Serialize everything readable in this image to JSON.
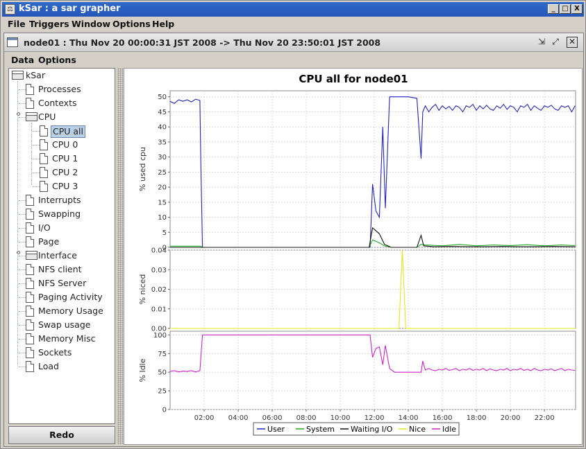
{
  "window": {
    "title": "kSar : a sar grapher",
    "controls": [
      "_",
      "□",
      "X"
    ]
  },
  "menubar": [
    "File",
    "Triggers",
    "Window",
    "Options",
    "Help"
  ],
  "inner_window": {
    "title": "node01 : Thu Nov 20 00:00:31 JST 2008 -> Thu Nov 20 23:50:01 JST 2008",
    "menus": [
      "Data",
      "Options"
    ]
  },
  "tree": {
    "root": "kSar",
    "items": [
      {
        "label": "Processes",
        "type": "leaf",
        "level": 1
      },
      {
        "label": "Contexts",
        "type": "leaf",
        "level": 1
      },
      {
        "label": "CPU",
        "type": "folder",
        "level": 1
      },
      {
        "label": "CPU all",
        "type": "leaf",
        "level": 2,
        "selected": true
      },
      {
        "label": "CPU 0",
        "type": "leaf",
        "level": 2
      },
      {
        "label": "CPU 1",
        "type": "leaf",
        "level": 2
      },
      {
        "label": "CPU 2",
        "type": "leaf",
        "level": 2
      },
      {
        "label": "CPU 3",
        "type": "leaf",
        "level": 2
      },
      {
        "label": "Interrupts",
        "type": "leaf",
        "level": 1
      },
      {
        "label": "Swapping",
        "type": "leaf",
        "level": 1
      },
      {
        "label": "I/O",
        "type": "leaf",
        "level": 1
      },
      {
        "label": "Page",
        "type": "leaf",
        "level": 1
      },
      {
        "label": "Interface",
        "type": "folder",
        "level": 1
      },
      {
        "label": "NFS client",
        "type": "leaf",
        "level": 1
      },
      {
        "label": "NFS Server",
        "type": "leaf",
        "level": 1
      },
      {
        "label": "Paging Activity",
        "type": "leaf",
        "level": 1
      },
      {
        "label": "Memory Usage",
        "type": "leaf",
        "level": 1
      },
      {
        "label": "Swap usage",
        "type": "leaf",
        "level": 1
      },
      {
        "label": "Memory Misc",
        "type": "leaf",
        "level": 1
      },
      {
        "label": "Sockets",
        "type": "leaf",
        "level": 1
      },
      {
        "label": "Load",
        "type": "leaf",
        "level": 1
      }
    ]
  },
  "redo_label": "Redo",
  "colors": {
    "user": "#2222bb",
    "system": "#22aa22",
    "waiting_io": "#111111",
    "nice": "#e6e61e",
    "idle": "#cc22cc"
  },
  "chart_data": {
    "type": "line",
    "title": "CPU all for node01",
    "x_ticks": [
      "02:00",
      "04:00",
      "06:00",
      "08:00",
      "10:00",
      "12:00",
      "14:00",
      "16:00",
      "18:00",
      "20:00",
      "22:00"
    ],
    "x_range_hours": [
      0,
      23.83
    ],
    "subplots": [
      {
        "ylabel": "% used cpu",
        "ylim": [
          0,
          52
        ],
        "y_ticks": [
          "0",
          "5",
          "10",
          "15",
          "20",
          "25",
          "30",
          "35",
          "40",
          "45",
          "50"
        ],
        "series": [
          {
            "name": "User",
            "color": "#2222bb",
            "x": [
              0,
              0.25,
              0.5,
              0.75,
              1.0,
              1.25,
              1.5,
              1.75,
              1.8,
              1.9,
              11.75,
              11.9,
              12.1,
              12.3,
              12.5,
              12.65,
              12.9,
              13.1,
              13.3,
              13.5,
              13.7,
              14.0,
              14.5,
              14.75,
              14.85,
              15.0,
              15.2,
              15.4,
              15.6,
              15.8,
              16.0,
              16.2,
              16.4,
              16.6,
              16.8,
              17.0,
              17.2,
              17.4,
              17.6,
              17.8,
              18.0,
              18.2,
              18.4,
              18.6,
              18.8,
              19.0,
              19.2,
              19.4,
              19.6,
              19.8,
              20.0,
              20.2,
              20.4,
              20.6,
              20.8,
              21.0,
              21.2,
              21.4,
              21.6,
              21.8,
              22.0,
              22.2,
              22.4,
              22.6,
              22.8,
              23.0,
              23.2,
              23.4,
              23.6,
              23.8
            ],
            "y": [
              48.5,
              47.8,
              49,
              48.5,
              49,
              48.3,
              49.2,
              48.8,
              30,
              0,
              0,
              21,
              12,
              10,
              40,
              13,
              50,
              50,
              50,
              50,
              50,
              50,
              49.5,
              29.5,
              45,
              47,
              45,
              46.5,
              47.5,
              45.5,
              47,
              46,
              46.8,
              45.5,
              47,
              46.5,
              45,
              47,
              46.5,
              47.5,
              45.5,
              47,
              46,
              47.2,
              46,
              45.5,
              47,
              46.2,
              47.5,
              45.8,
              47,
              46.5,
              45,
              47,
              46.5,
              47.5,
              45.5,
              47,
              46.2,
              45.5,
              47,
              46.5,
              47.2,
              46,
              45.5,
              47,
              46.5,
              47,
              45,
              47
            ]
          },
          {
            "name": "System",
            "color": "#22aa22",
            "x": [
              0,
              1.8,
              1.9,
              11.7,
              11.9,
              12.3,
              12.6,
              13.0,
              14.5,
              14.75,
              15.0,
              16.0,
              17.0,
              18.0,
              19.0,
              20.0,
              21.0,
              22.0,
              23.0,
              23.8
            ],
            "y": [
              0.4,
              0.4,
              0,
              0,
              2.5,
              1.5,
              0.5,
              0,
              0,
              1.0,
              0.8,
              0.5,
              1.0,
              0.5,
              0.8,
              0.6,
              0.9,
              0.5,
              0.8,
              0.6
            ]
          },
          {
            "name": "Waiting I/O",
            "color": "#111111",
            "x": [
              0,
              1.8,
              1.9,
              11.7,
              11.9,
              12.3,
              12.6,
              13.0,
              14.5,
              14.75,
              14.9,
              15.5,
              16.5,
              17.5,
              18.5,
              19.5,
              20.5,
              21.5,
              22.5,
              23.8
            ],
            "y": [
              0,
              0,
              0,
              0,
              6.5,
              4.5,
              1.0,
              0,
              0,
              4.0,
              0.5,
              0.2,
              0.3,
              0.2,
              0.2,
              0.3,
              0.2,
              0.2,
              0.3,
              0.2
            ]
          }
        ]
      },
      {
        "ylabel": "% niced",
        "ylim": [
          0,
          0.04
        ],
        "y_ticks": [
          "0.00",
          "0.01",
          "0.02",
          "0.03",
          "0.04"
        ],
        "series": [
          {
            "name": "Nice",
            "color": "#e6e61e",
            "x": [
              0,
              13.45,
              13.65,
              13.85,
              23.83
            ],
            "y": [
              0,
              0,
              0.04,
              0,
              0
            ]
          }
        ]
      },
      {
        "ylabel": "% Idle",
        "ylim": [
          0,
          105
        ],
        "y_ticks": [
          "0",
          "25",
          "50",
          "75",
          "100"
        ],
        "series": [
          {
            "name": "Idle",
            "color": "#cc22cc",
            "x": [
              0,
              0.25,
              0.5,
              0.75,
              1.0,
              1.25,
              1.5,
              1.75,
              1.9,
              11.75,
              11.9,
              12.1,
              12.3,
              12.5,
              12.65,
              12.9,
              13.2,
              14.0,
              14.5,
              14.75,
              14.85,
              15.0,
              15.2,
              15.4,
              15.6,
              15.8,
              16.0,
              16.2,
              16.4,
              16.6,
              16.8,
              17.0,
              17.2,
              17.4,
              17.6,
              17.8,
              18.0,
              18.2,
              18.4,
              18.6,
              18.8,
              19.0,
              19.2,
              19.4,
              19.6,
              19.8,
              20.0,
              20.2,
              20.4,
              20.6,
              20.8,
              21.0,
              21.2,
              21.4,
              21.6,
              21.8,
              22.0,
              22.2,
              22.4,
              22.6,
              22.8,
              23.0,
              23.2,
              23.4,
              23.6,
              23.8
            ],
            "y": [
              51,
              52,
              50.5,
              51.5,
              51,
              52,
              50.5,
              52,
              100,
              100,
              70,
              82,
              84,
              60,
              86,
              55,
              50,
              50,
              50,
              50,
              65,
              53,
              55,
              53,
              52,
              54,
              53,
              55,
              52.5,
              53.5,
              55,
              52,
              54,
              53,
              55,
              52.5,
              54,
              53,
              55,
              52,
              54.5,
              53,
              52,
              54,
              53,
              55,
              52,
              54,
              53,
              55,
              52.5,
              54,
              52,
              55,
              53,
              52,
              54,
              53,
              54.5,
              52,
              53.5,
              55,
              52,
              54,
              53,
              52.5
            ]
          }
        ]
      }
    ],
    "legend": [
      "User",
      "System",
      "Waiting I/O",
      "Nice",
      "Idle"
    ],
    "legend_position": "bottom-center",
    "grid": true
  }
}
